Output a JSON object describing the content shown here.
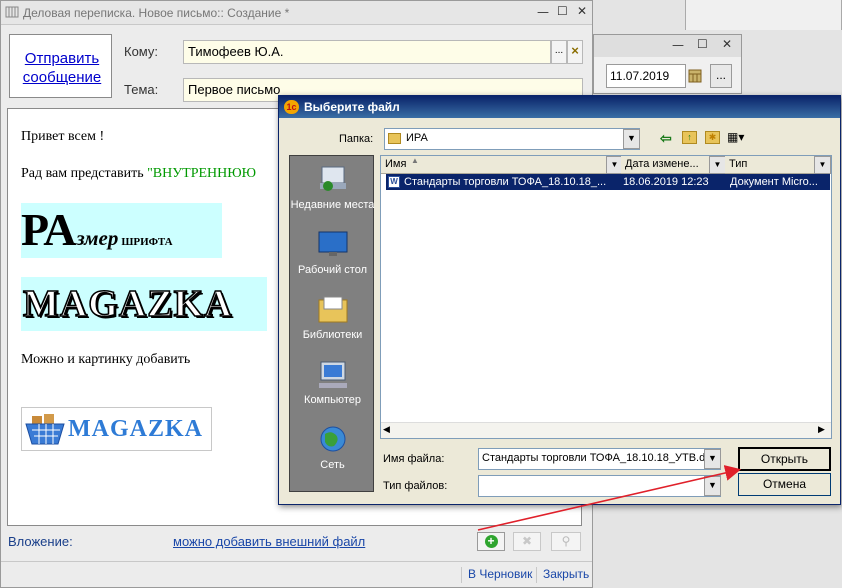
{
  "main_window": {
    "title": "Деловая переписка. Новое письмо:: Создание *",
    "send_link": "Отправить сообщение",
    "to_label": "Кому:",
    "to_value": "Тимофеев Ю.А.",
    "to_select_btn": "...",
    "to_clear_btn": "×",
    "subject_label": "Тема:",
    "subject_value": "Первое письмо",
    "body": {
      "greeting": "Привет всем !",
      "intro": "Рад вам представить",
      "intro_green": "\"ВНУТРЕННЮЮ",
      "size_big": "РА",
      "size_mid": "змер",
      "size_small": "шрифта",
      "magazka": "MAGAZKA",
      "picture_text": "Можно и картинку добавить",
      "logo_text": "MAGAZKA"
    },
    "attach_label": "Вложение:",
    "attach_link": "можно добавить внешний файл",
    "status_draft": "В Черновик",
    "status_close": "Закрыть"
  },
  "second_window": {
    "date_value": "11.07.2019",
    "more_btn": "..."
  },
  "file_dialog": {
    "title": "Выберите файл",
    "folder_label": "Папка:",
    "folder_value": "ИРА",
    "places": [
      {
        "label": "Недавние места",
        "icon": "recent-places-icon"
      },
      {
        "label": "Рабочий стол",
        "icon": "desktop-icon"
      },
      {
        "label": "Библиотеки",
        "icon": "libraries-icon"
      },
      {
        "label": "Компьютер",
        "icon": "computer-icon"
      },
      {
        "label": "Сеть",
        "icon": "network-icon"
      }
    ],
    "columns": [
      "Имя",
      "Дата измене...",
      "Тип"
    ],
    "files": [
      {
        "name": "Стандарты торговли ТОФА_18.10.18_...",
        "date": "18.06.2019 12:23",
        "type": "Документ Micro..."
      }
    ],
    "filename_label": "Имя файла:",
    "filename_value": "Стандарты торговли ТОФА_18.10.18_УТВ.d",
    "filetype_label": "Тип файлов:",
    "filetype_value": "",
    "open_btn": "Открыть",
    "cancel_btn": "Отмена"
  },
  "colors": {
    "accent": "#0a246a",
    "link": "#0000cc",
    "green_text": "#009900",
    "arrow": "#e0202a"
  }
}
